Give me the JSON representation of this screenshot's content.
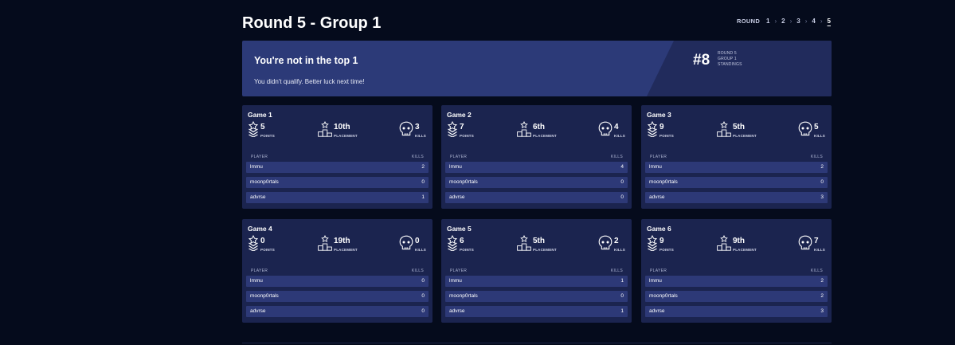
{
  "page_title": "Round 5 - Group 1",
  "round_nav": {
    "label": "ROUND",
    "items": [
      "1",
      "2",
      "3",
      "4",
      "5"
    ],
    "active": "5"
  },
  "banner": {
    "title": "You're not in the top 1",
    "subtitle": "You didn't qualify. Better luck next time!",
    "rank": "#8",
    "meta": [
      "ROUND 5",
      "GROUP 1",
      "STANDINGS"
    ]
  },
  "labels": {
    "points": "POINTS",
    "placement": "PLACEMENT",
    "kills": "KILLS",
    "player_col": "PLAYER",
    "kills_col": "KILLS"
  },
  "icons": {
    "points": "chevron-badge-icon",
    "placement": "podium-star-icon",
    "kills": "skull-icon"
  },
  "colors": {
    "background": "#050b1c",
    "card": "#1b244f",
    "row": "#2d3977",
    "banner": "#2c3a78",
    "banner_dark": "#212b5c"
  },
  "games": [
    {
      "title": "Game 1",
      "points": "5",
      "placement": "10th",
      "kills": "3",
      "players": [
        {
          "name": "lmmu",
          "kills": "2"
        },
        {
          "name": "moonp0rtals",
          "kills": "0"
        },
        {
          "name": "advrse",
          "kills": "1"
        }
      ]
    },
    {
      "title": "Game 2",
      "points": "7",
      "placement": "6th",
      "kills": "4",
      "players": [
        {
          "name": "lmmu",
          "kills": "4"
        },
        {
          "name": "moonp0rtals",
          "kills": "0"
        },
        {
          "name": "advrse",
          "kills": "0"
        }
      ]
    },
    {
      "title": "Game 3",
      "points": "9",
      "placement": "5th",
      "kills": "5",
      "players": [
        {
          "name": "lmmu",
          "kills": "2"
        },
        {
          "name": "moonp0rtals",
          "kills": "0"
        },
        {
          "name": "advrse",
          "kills": "3"
        }
      ]
    },
    {
      "title": "Game 4",
      "points": "0",
      "placement": "19th",
      "kills": "0",
      "players": [
        {
          "name": "lmmu",
          "kills": "0"
        },
        {
          "name": "moonp0rtals",
          "kills": "0"
        },
        {
          "name": "advrse",
          "kills": "0"
        }
      ]
    },
    {
      "title": "Game 5",
      "points": "6",
      "placement": "5th",
      "kills": "2",
      "players": [
        {
          "name": "lmmu",
          "kills": "1"
        },
        {
          "name": "moonp0rtals",
          "kills": "0"
        },
        {
          "name": "advrse",
          "kills": "1"
        }
      ]
    },
    {
      "title": "Game 6",
      "points": "9",
      "placement": "9th",
      "kills": "7",
      "players": [
        {
          "name": "lmmu",
          "kills": "2"
        },
        {
          "name": "moonp0rtals",
          "kills": "2"
        },
        {
          "name": "advrse",
          "kills": "3"
        }
      ]
    }
  ]
}
